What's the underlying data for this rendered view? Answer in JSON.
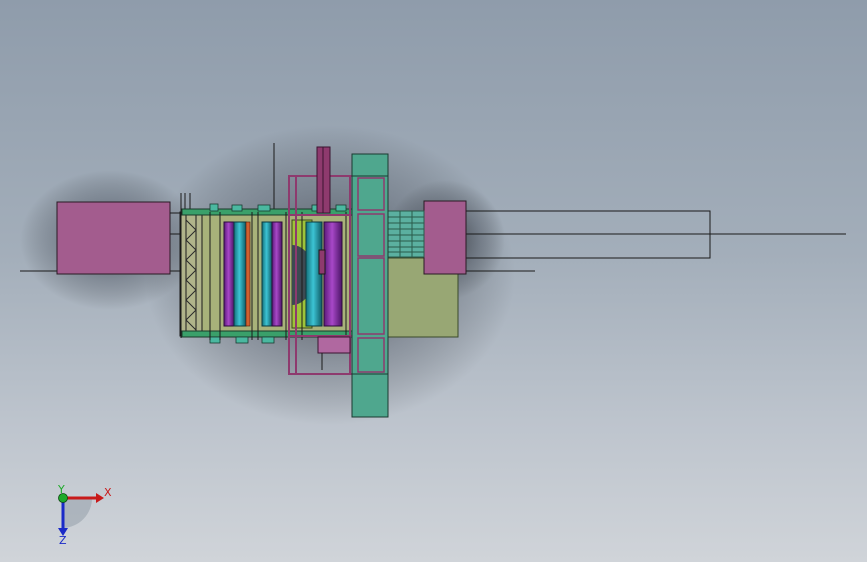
{
  "viewport": {
    "name": "cad-graphics-area"
  },
  "triad": {
    "x_label": "X",
    "y_label": "Y",
    "z_label": "Z",
    "x_color": "#c81a1a",
    "y_color": "#1eaa2a",
    "z_color": "#1a2ac8"
  },
  "colors": {
    "magenta_block": "#a35c8e",
    "magenta_frame": "#8e3a6e",
    "teal": "#4fa78e",
    "olive": "#98a774",
    "purple_roller": "#8a34a8",
    "cyan_roller": "#2aa4b4",
    "lime": "#9ec33a",
    "line": "#1a1a1a"
  }
}
